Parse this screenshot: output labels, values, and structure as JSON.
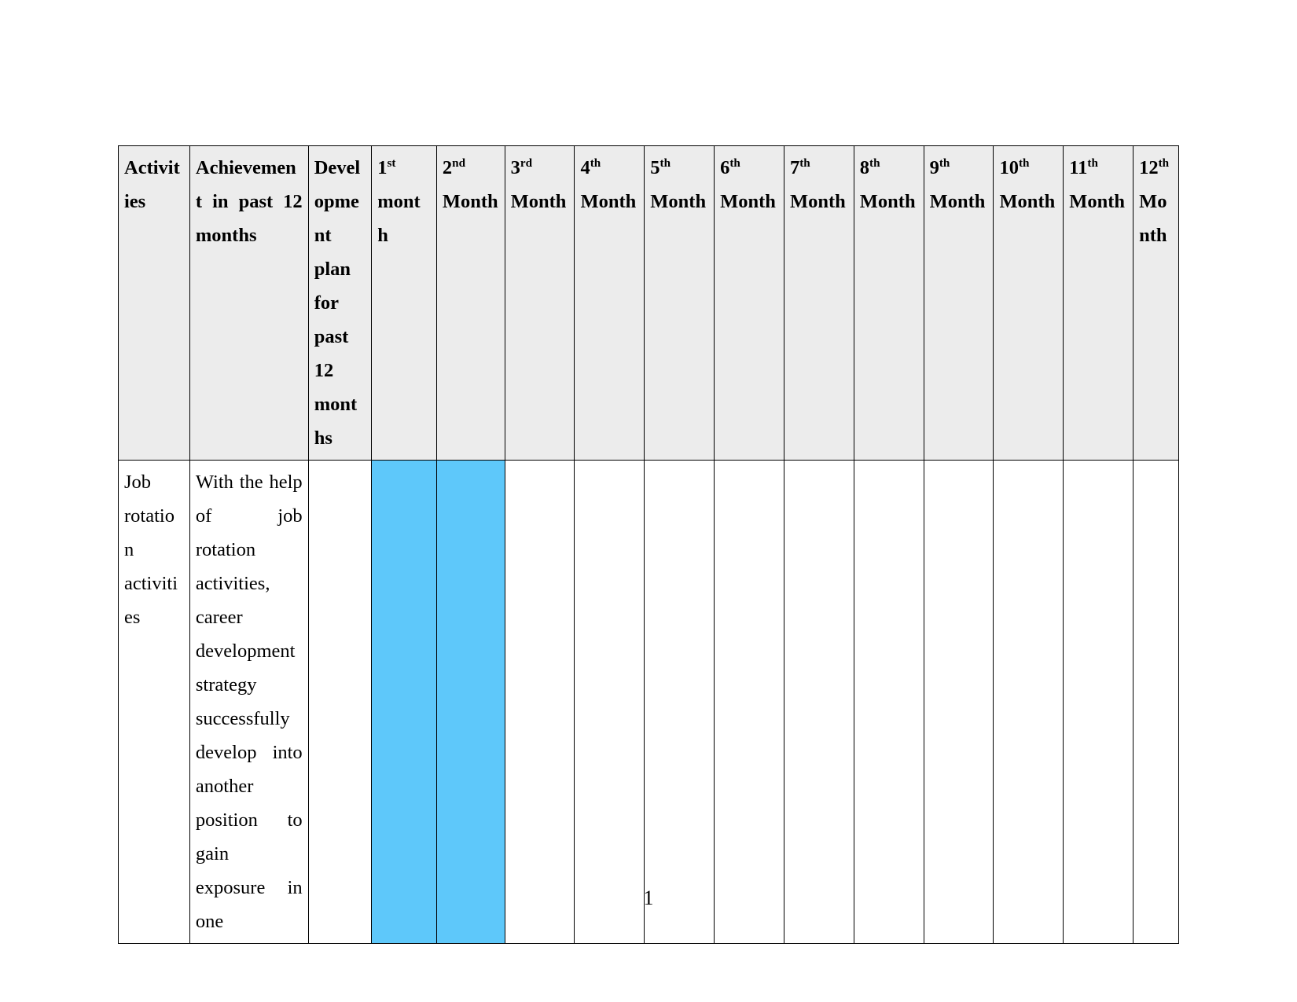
{
  "document": {
    "page_number": "1",
    "header_background": "#ECECEC",
    "fill_color": "#5EC8FA",
    "border_color": "#000000"
  },
  "table": {
    "headers": [
      {
        "text": "Activities",
        "ordinal": "",
        "suffix": ""
      },
      {
        "text": "Achievement in past 12 months",
        "ordinal": "",
        "suffix": ""
      },
      {
        "text": "Development plan for past 12 months",
        "ordinal": "",
        "suffix": ""
      },
      {
        "text": "month",
        "ordinal": "1",
        "suffix": "st"
      },
      {
        "text": "Month",
        "ordinal": "2",
        "suffix": "nd"
      },
      {
        "text": "Month",
        "ordinal": "3",
        "suffix": "rd"
      },
      {
        "text": "Month",
        "ordinal": "4",
        "suffix": "th"
      },
      {
        "text": "Month",
        "ordinal": "5",
        "suffix": "th"
      },
      {
        "text": "Month",
        "ordinal": "6",
        "suffix": "th"
      },
      {
        "text": "Month",
        "ordinal": "7",
        "suffix": "th"
      },
      {
        "text": "Month",
        "ordinal": "8",
        "suffix": "th"
      },
      {
        "text": "Month",
        "ordinal": "9",
        "suffix": "th"
      },
      {
        "text": "Month",
        "ordinal": "10",
        "suffix": "th"
      },
      {
        "text": "Month",
        "ordinal": "11",
        "suffix": "th"
      },
      {
        "text": "Month",
        "ordinal": "12",
        "suffix": "th"
      }
    ],
    "rows": [
      {
        "activity": "Job rotation activities",
        "achievement": "With the help of job rotation activities, career development strategy successfully develop into another position to gain exposure in one",
        "development_plan": "",
        "months": [
          {
            "month": "1",
            "filled": true
          },
          {
            "month": "2",
            "filled": true
          },
          {
            "month": "3",
            "filled": false
          },
          {
            "month": "4",
            "filled": false
          },
          {
            "month": "5",
            "filled": false
          },
          {
            "month": "6",
            "filled": false
          },
          {
            "month": "7",
            "filled": false
          },
          {
            "month": "8",
            "filled": false
          },
          {
            "month": "9",
            "filled": false
          },
          {
            "month": "10",
            "filled": false
          },
          {
            "month": "11",
            "filled": false
          },
          {
            "month": "12",
            "filled": false
          }
        ]
      }
    ]
  }
}
